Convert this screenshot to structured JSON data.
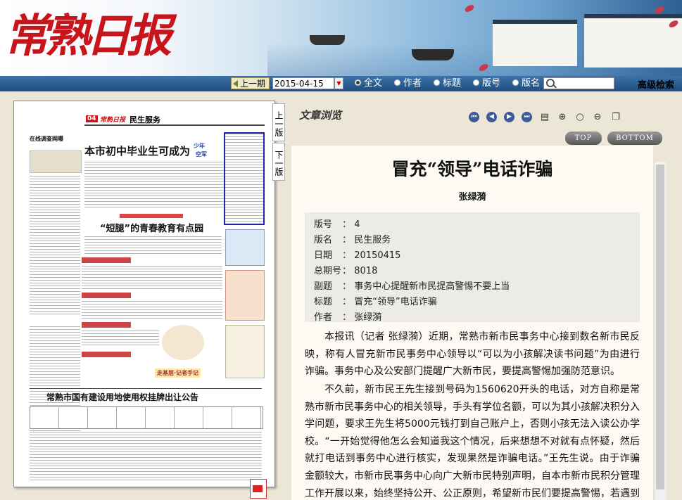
{
  "header": {
    "logo_text": "常熟日报"
  },
  "searchbar": {
    "prev_label": "上一期",
    "date_value": "2015-04-15",
    "options": [
      "全文",
      "作者",
      "标题",
      "版号",
      "版名"
    ],
    "selected_option": "全文",
    "advanced_label": "高级检索"
  },
  "newspaper": {
    "page_badge": "04",
    "paper_name": "常熟日报",
    "section_name": "民生服务",
    "headline_main": "本市初中毕业生可成为",
    "headline_tag_1": "少年",
    "headline_tag_2": "空军",
    "headline_second": "“短腿”的青春教育有点园",
    "headline_bottom": "常熟市国有建设用地使用权挂牌出让公告",
    "left_col_heading": "在线调查网曝",
    "promo_text": "走基层·记者手记"
  },
  "page_nav": {
    "prev_page": "上一版",
    "next_page": "下一版"
  },
  "viewer": {
    "title": "文章浏览",
    "top_label": "TOP",
    "bottom_label": "BOTTOM"
  },
  "article": {
    "title": "冒充“领导”电话诈骗",
    "author": "张绿漪",
    "meta": [
      {
        "key": "版号",
        "value": "4"
      },
      {
        "key": "版名",
        "value": "民生服务"
      },
      {
        "key": "日期",
        "value": "20150415"
      },
      {
        "key": "总期号",
        "value": "8018"
      },
      {
        "key": "副题",
        "value": "事务中心提醒新市民提高警惕不要上当"
      },
      {
        "key": "标题",
        "value": "冒充“领导”电话诈骗"
      },
      {
        "key": "作者",
        "value": "张绿漪"
      }
    ],
    "paragraphs": [
      "本报讯（记者 张绿漪）近期，常熟市新市民事务中心接到数名新市民反映，称有人冒充新市民事务中心领导以“可以为小孩解决读书问题”为由进行诈骗。事务中心及公安部门提醒广大新市民，要提高警惕加强防范意识。",
      "不久前，新市民王先生接到号码为1560620开头的电话，对方自称是常熟市新市民事务中心的相关领导，手头有学位名额，可以为其小孩解决积分入学问题，要求王先生将5000元钱打到自己账户上，否则小孩无法入读公办学校。“一开始觉得他怎么会知道我这个情况，后来想想不对就有点怀疑，然后就打电话到事务中心进行核实，发现果然是诈骗电话。”王先生说。由于诈骗金额较大，市新市民事务中心向广大新市民特别声明，自本市新市民积分管理工作开展以来，始终坚持公开、公正原则，希望新市民们要提高警惕，若遇到"
    ]
  },
  "colors": {
    "brand_red": "#c8151b",
    "bar_blue": "#2a5c92",
    "bg": "#ece6d6"
  }
}
